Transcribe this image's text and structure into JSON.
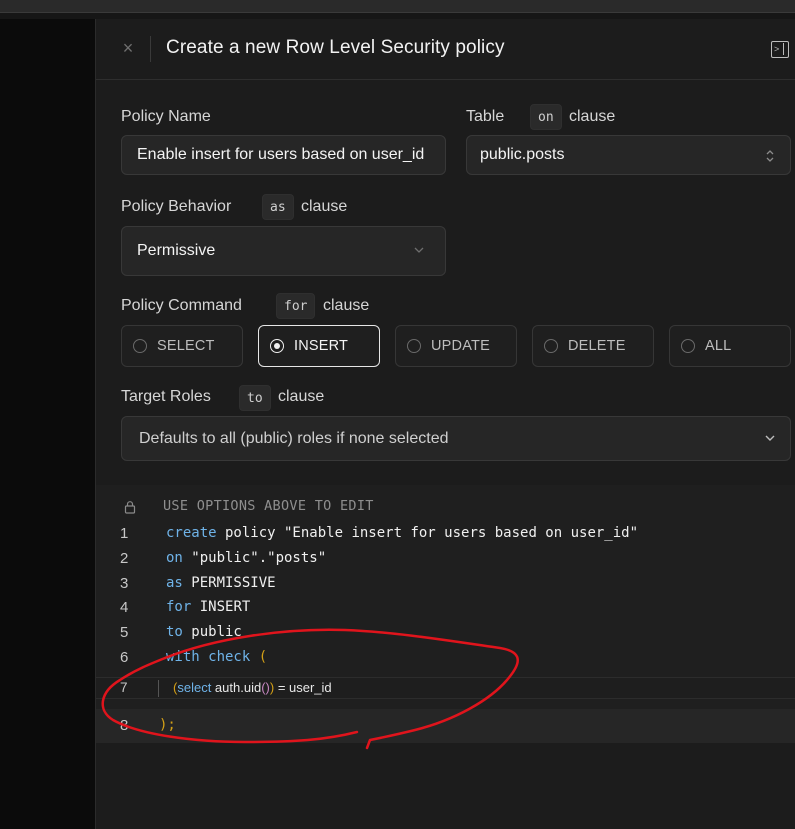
{
  "window": {
    "title": "Create a new Row Level Security policy",
    "close_glyph": "×"
  },
  "form": {
    "policy_name": {
      "label": "Policy Name",
      "value": "Enable insert for users based on user_id"
    },
    "table": {
      "label": "Table",
      "chip": "on",
      "clause": "clause",
      "value": "public.posts"
    },
    "behavior": {
      "label": "Policy Behavior",
      "chip": "as",
      "clause": "clause",
      "value": "Permissive"
    },
    "command": {
      "label": "Policy Command",
      "chip": "for",
      "clause": "clause",
      "options": [
        "SELECT",
        "INSERT",
        "UPDATE",
        "DELETE",
        "ALL"
      ],
      "selected": "INSERT"
    },
    "roles": {
      "label": "Target Roles",
      "chip": "to",
      "clause": "clause",
      "placeholder": "Defaults to all (public) roles if none selected"
    }
  },
  "editor": {
    "readonly_note": "USE OPTIONS ABOVE TO EDIT",
    "lines": [
      {
        "n": "1",
        "kw": "create",
        "rest": " policy \"Enable insert for users based on user_id\""
      },
      {
        "n": "2",
        "kw": "on",
        "rest": " \"public\".\"posts\""
      },
      {
        "n": "3",
        "kw": "as",
        "rest": " PERMISSIVE"
      },
      {
        "n": "4",
        "kw": "for",
        "rest": " INSERT"
      },
      {
        "n": "5",
        "kw": "to",
        "rest": " public"
      },
      {
        "n": "6",
        "kw": "with check",
        "rest": " ("
      }
    ],
    "line7": {
      "n": "7",
      "open": "(",
      "kw": "select",
      "fn": " auth.uid",
      "call": "()",
      "close": ")",
      "rest": " = user_id"
    },
    "line8": {
      "n": "8",
      "text": ");"
    }
  },
  "colors": {
    "keyword": "#6fb3e8",
    "annotation": "#e0141c"
  },
  "icons": {
    "close": "close-icon",
    "sidebar": "sidebar-toggle-icon",
    "lock": "lock-icon",
    "chevron": "chevron-down-icon"
  }
}
